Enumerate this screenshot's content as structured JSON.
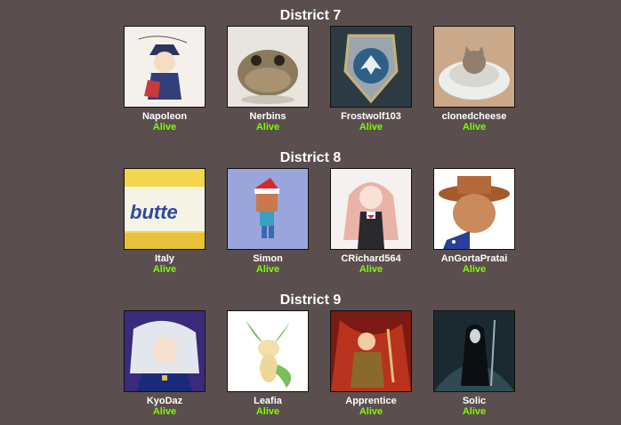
{
  "colors": {
    "background": "#5a4f4e",
    "alive": "#7cfc00",
    "name": "#ffffff"
  },
  "districts": [
    {
      "title": "District 7",
      "tributes": [
        {
          "name": "Napoleon",
          "status": "Alive",
          "avatar_icon": "anime-soldier-icon"
        },
        {
          "name": "Nerbins",
          "status": "Alive",
          "avatar_icon": "frog-icon"
        },
        {
          "name": "Frostwolf103",
          "status": "Alive",
          "avatar_icon": "wolf-crest-icon"
        },
        {
          "name": "clonedcheese",
          "status": "Alive",
          "avatar_icon": "cat-in-bed-icon"
        }
      ]
    },
    {
      "title": "District 8",
      "tributes": [
        {
          "name": "Italy",
          "status": "Alive",
          "avatar_icon": "butter-tub-icon"
        },
        {
          "name": "Simon",
          "status": "Alive",
          "avatar_icon": "pixel-santa-icon"
        },
        {
          "name": "CRichard564",
          "status": "Alive",
          "avatar_icon": "anime-girl-icon"
        },
        {
          "name": "AnGortaPratai",
          "status": "Alive",
          "avatar_icon": "cowboy-wojak-icon"
        }
      ]
    },
    {
      "title": "District 9",
      "tributes": [
        {
          "name": "KyoDaz",
          "status": "Alive",
          "avatar_icon": "anime-white-hair-icon"
        },
        {
          "name": "Leafia",
          "status": "Alive",
          "avatar_icon": "leafeon-icon"
        },
        {
          "name": "Apprentice",
          "status": "Alive",
          "avatar_icon": "warrior-icon"
        },
        {
          "name": "Solic",
          "status": "Alive",
          "avatar_icon": "reaper-icon"
        }
      ]
    }
  ]
}
